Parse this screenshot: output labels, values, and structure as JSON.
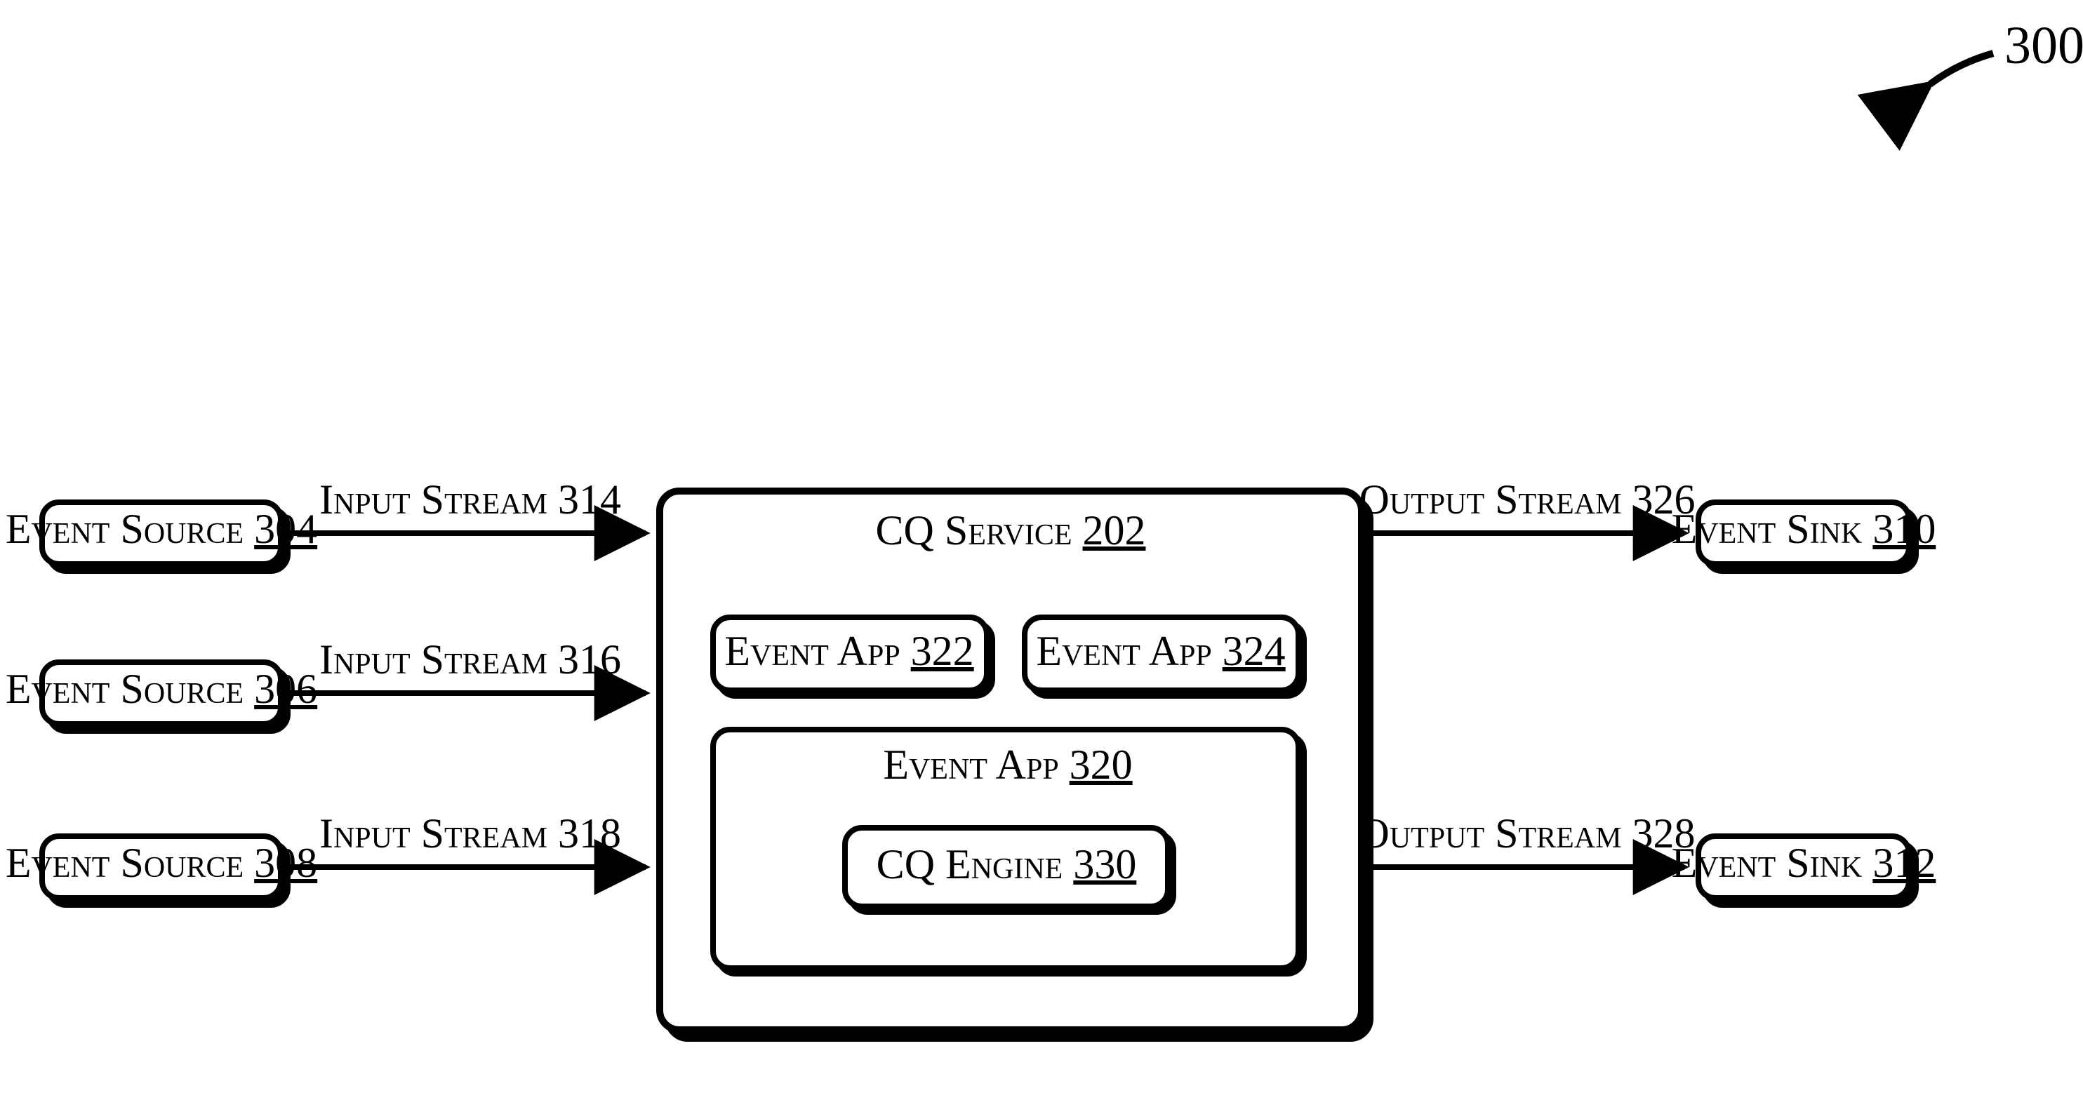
{
  "figure_ref": "300",
  "sources": [
    {
      "label": "Event Source",
      "num": "304"
    },
    {
      "label": "Event Source",
      "num": "306"
    },
    {
      "label": "Event Source",
      "num": "308"
    }
  ],
  "inputs": [
    {
      "label": "Input Stream",
      "num": "314"
    },
    {
      "label": "Input Stream",
      "num": "316"
    },
    {
      "label": "Input Stream",
      "num": "318"
    }
  ],
  "service": {
    "label": "CQ Service",
    "num": "202"
  },
  "apps": [
    {
      "label": "Event App",
      "num": "322"
    },
    {
      "label": "Event App",
      "num": "324"
    },
    {
      "label": "Event App",
      "num": "320"
    }
  ],
  "engine": {
    "label": "CQ Engine",
    "num": "330"
  },
  "outputs": [
    {
      "label": "Output Stream",
      "num": "326"
    },
    {
      "label": "Output Stream",
      "num": "328"
    }
  ],
  "sinks": [
    {
      "label": "Event Sink",
      "num": "310"
    },
    {
      "label": "Event Sink",
      "num": "312"
    }
  ]
}
